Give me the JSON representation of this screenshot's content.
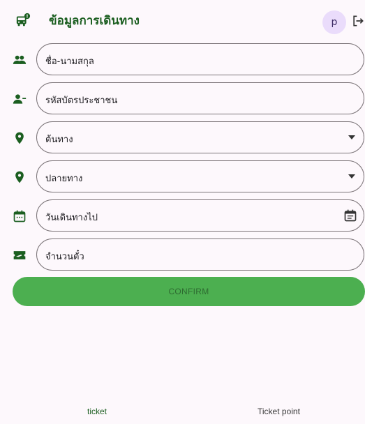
{
  "header": {
    "title": "ข้อมูลการเดินทาง",
    "avatar_letter": "p"
  },
  "form": {
    "name_label": "ชื่อ-นามสกุล",
    "id_label": "รหัสบัตรประชาชน",
    "origin_label": "ต้นทาง",
    "destination_label": "ปลายทาง",
    "date_label": "วันเดินทางไป",
    "tickets_label": "จำนวนตั๋ว"
  },
  "confirm_label": "CONFIRM",
  "bottom_nav": {
    "ticket": "ticket",
    "point": "Ticket point"
  },
  "colors": {
    "accent": "#1b5e20",
    "button": "#4caf50",
    "avatar": "#eadcfb"
  }
}
